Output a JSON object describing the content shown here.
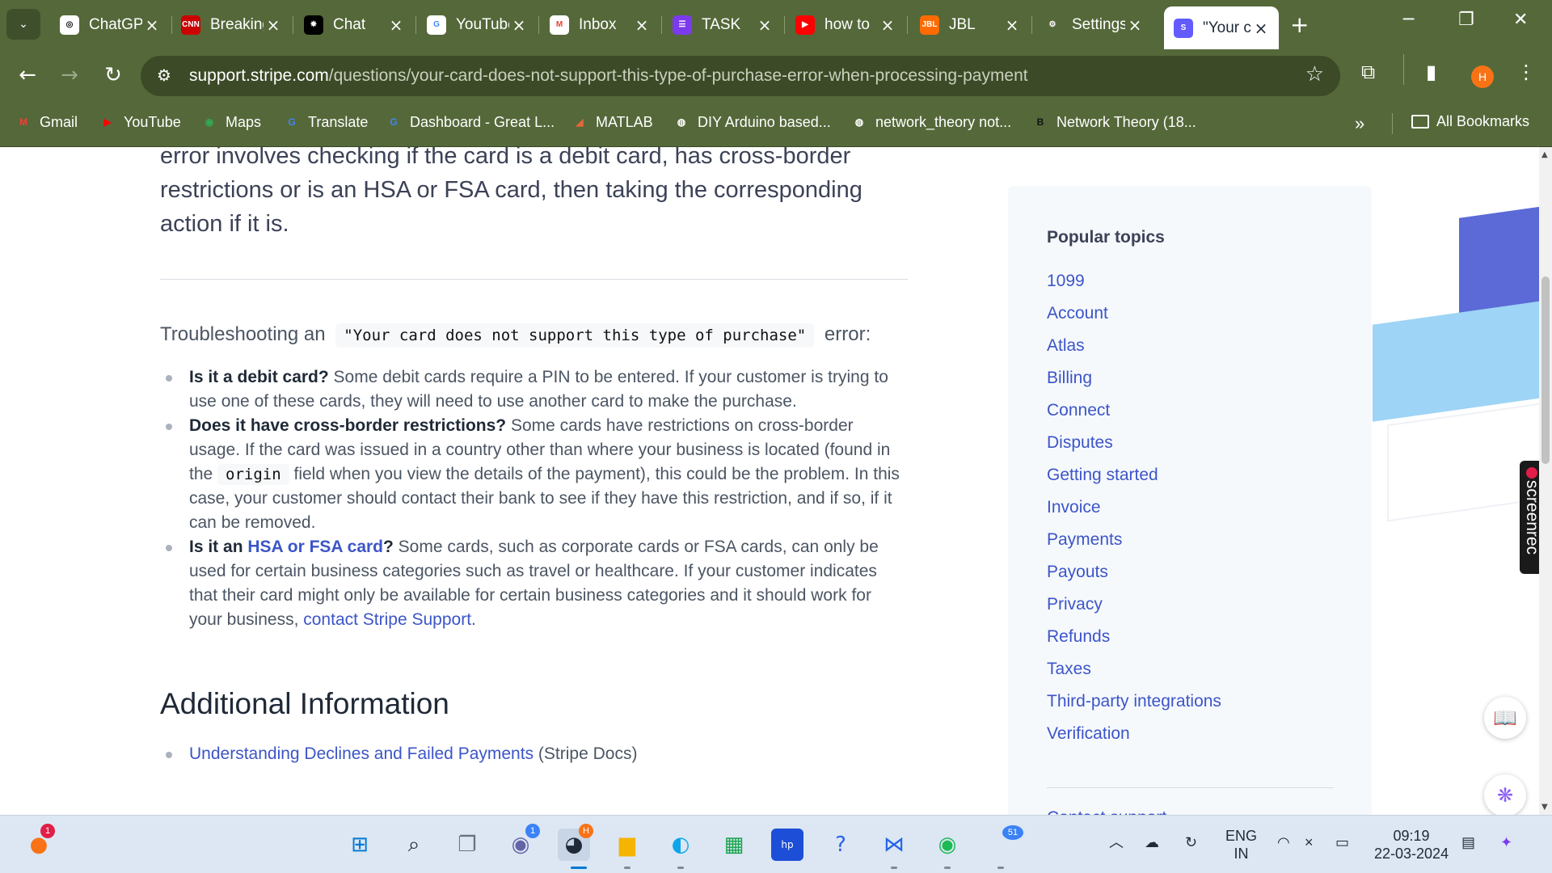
{
  "tabs": [
    {
      "label": "ChatGPT",
      "icon": "chatgpt-icon",
      "bg": "#ffffff",
      "fg": "#111111",
      "glyph": "◎"
    },
    {
      "label": "Breaking News",
      "icon": "cnn-icon",
      "bg": "#cc0000",
      "fg": "#ffffff",
      "glyph": "CNN"
    },
    {
      "label": "Chat",
      "icon": "chat-icon",
      "bg": "#000000",
      "fg": "#ffffff",
      "glyph": "✸"
    },
    {
      "label": "YouTube",
      "icon": "google-icon",
      "bg": "#ffffff",
      "fg": "#4285f4",
      "glyph": "G"
    },
    {
      "label": "Inbox",
      "icon": "gmail-icon",
      "bg": "#ffffff",
      "fg": "#ea4335",
      "glyph": "M"
    },
    {
      "label": "TASK",
      "icon": "tasks-icon",
      "bg": "#7c3aed",
      "fg": "#ffffff",
      "glyph": "☰"
    },
    {
      "label": "how to",
      "icon": "youtube-icon",
      "bg": "#ff0000",
      "fg": "#ffffff",
      "glyph": "▶"
    },
    {
      "label": "JBL",
      "icon": "jbl-icon",
      "bg": "#ff6b00",
      "fg": "#ffffff",
      "glyph": "JBL"
    },
    {
      "label": "Settings",
      "icon": "settings-gear-icon",
      "bg": "#55683a",
      "fg": "#ffffff",
      "glyph": "⚙"
    },
    {
      "label": "\"Your card does not support",
      "icon": "stripe-icon",
      "bg": "#635bff",
      "fg": "#ffffff",
      "glyph": "S"
    }
  ],
  "url": {
    "domain": "support.stripe.com",
    "path": "/questions/your-card-does-not-support-this-type-of-purchase-error-when-processing-payment"
  },
  "profile_initial": "H",
  "bookmarks": [
    {
      "label": "Gmail",
      "glyph": "M",
      "color": "#ea4335"
    },
    {
      "label": "YouTube",
      "glyph": "▶",
      "color": "#ff0000"
    },
    {
      "label": "Maps",
      "glyph": "◉",
      "color": "#34a853"
    },
    {
      "label": "Translate",
      "glyph": "G",
      "color": "#4285f4"
    },
    {
      "label": "Dashboard - Great L...",
      "glyph": "G",
      "color": "#4285f4"
    },
    {
      "label": "MATLAB",
      "glyph": "◢",
      "color": "#e16737"
    },
    {
      "label": "DIY Arduino based...",
      "glyph": "◍",
      "color": "#ffffff"
    },
    {
      "label": "network_theory not...",
      "glyph": "◍",
      "color": "#ffffff"
    },
    {
      "label": "Network Theory (18...",
      "glyph": "B",
      "color": "#111111"
    }
  ],
  "all_bookmarks": "All Bookmarks",
  "article": {
    "intro": "error involves checking if the card is a debit card, has cross-border restrictions or is an HSA or FSA card, then taking the corresponding action if it is.",
    "trouble_prefix": "Troubleshooting an",
    "trouble_code": "\"Your card does not support this type of purchase\"",
    "trouble_suffix": "error:",
    "b1_bold": "Is it a debit card?",
    "b1_text": " Some debit cards require a PIN to be entered. If your customer is trying to use one of these cards, they will need to use another card to make the purchase.",
    "b2_bold": "Does it have cross-border restrictions?",
    "b2_text1": " Some cards have restrictions on cross-border usage. If the card was issued in a country other than where your business is located (found in the ",
    "b2_code": "origin",
    "b2_text2": " field when you view the details of the payment), this could be the problem. In this case, your customer should contact their bank to see if they have this restriction, and if so, if it can be removed.",
    "b3_bold1": "Is it an ",
    "b3_link": "HSA or FSA card",
    "b3_bold2": "?",
    "b3_text": " Some cards, such as corporate cards or FSA cards, can only be used for certain business categories such as travel or healthcare. If your customer indicates that their card might only be available for certain business categories and it should work for your business, ",
    "b3_link2": "contact Stripe Support",
    "b3_end": ".",
    "h2": "Additional Information",
    "add_link": "Understanding Declines and Failed Payments",
    "add_suffix": " (Stripe Docs)"
  },
  "sidebar": {
    "title": "Popular topics",
    "items": [
      "1099",
      "Account",
      "Atlas",
      "Billing",
      "Connect",
      "Disputes",
      "Getting started",
      "Invoice",
      "Payments",
      "Payouts",
      "Privacy",
      "Refunds",
      "Taxes",
      "Third-party integrations",
      "Verification"
    ],
    "contact": "Contact support"
  },
  "screenrec": "screenrec",
  "taskbar": {
    "lang1": "ENG",
    "lang2": "IN",
    "time": "09:19",
    "date": "22-03-2024",
    "notif_count": "1",
    "teams_badge": "1",
    "chrome_badge": "H",
    "app_badge": "51"
  }
}
